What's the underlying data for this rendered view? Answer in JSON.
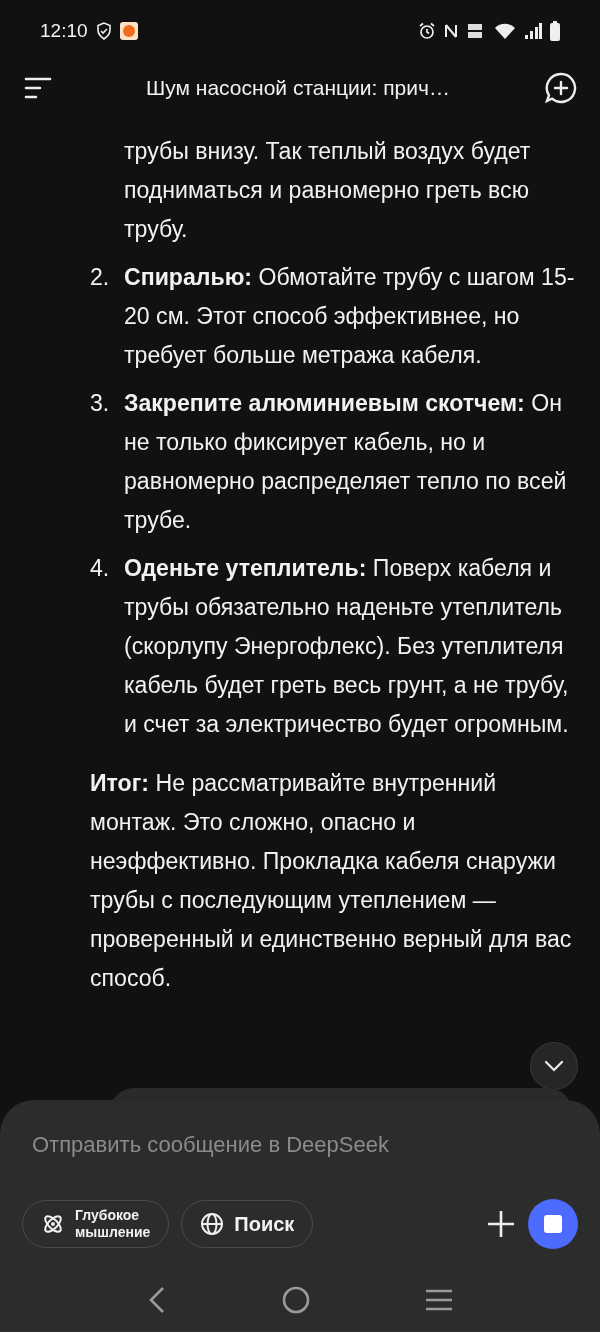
{
  "status_bar": {
    "time": "12:10"
  },
  "header": {
    "title": "Шум насосной станции: прич…"
  },
  "list_items": [
    {
      "text": "трубы внизу. Так теплый воздух будет подниматься и равномерно греть всю трубу."
    },
    {
      "number": "2.",
      "text": "**Спиралью:** Обмотайте трубу с шагом 15-20 см. Этот способ эффективнее, но требует больше метража кабеля."
    },
    {
      "number": "3.",
      "text": "**Закрепите алюминиевым скотчем:** Он не только фиксирует кабель, но и равномерно распределяет тепло по всей трубе."
    },
    {
      "number": "4.",
      "text": "**Оденьте утеплитель:** Поверх кабеля и трубы обязательно наденьте утеплитель (скорлупу Энергофлекс). Без утеплителя кабель будет греть весь грунт, а не трубу, и счет за электричество будет огромным."
    }
  ],
  "summary": "**Итог:** Не рассматривайте внутренний монтаж. Это сложно, опасно и неэффективно. Прокладка кабеля снаружи трубы с последующим утеплением — проверенный и единственно верный для вас способ.",
  "composer": {
    "placeholder": "Отправить сообщение в DeepSeek",
    "chips": [
      {
        "kind": "think",
        "label": "Глубокое мышление",
        "selected": false
      },
      {
        "kind": "search",
        "label": "Поиск",
        "selected": false
      }
    ]
  }
}
